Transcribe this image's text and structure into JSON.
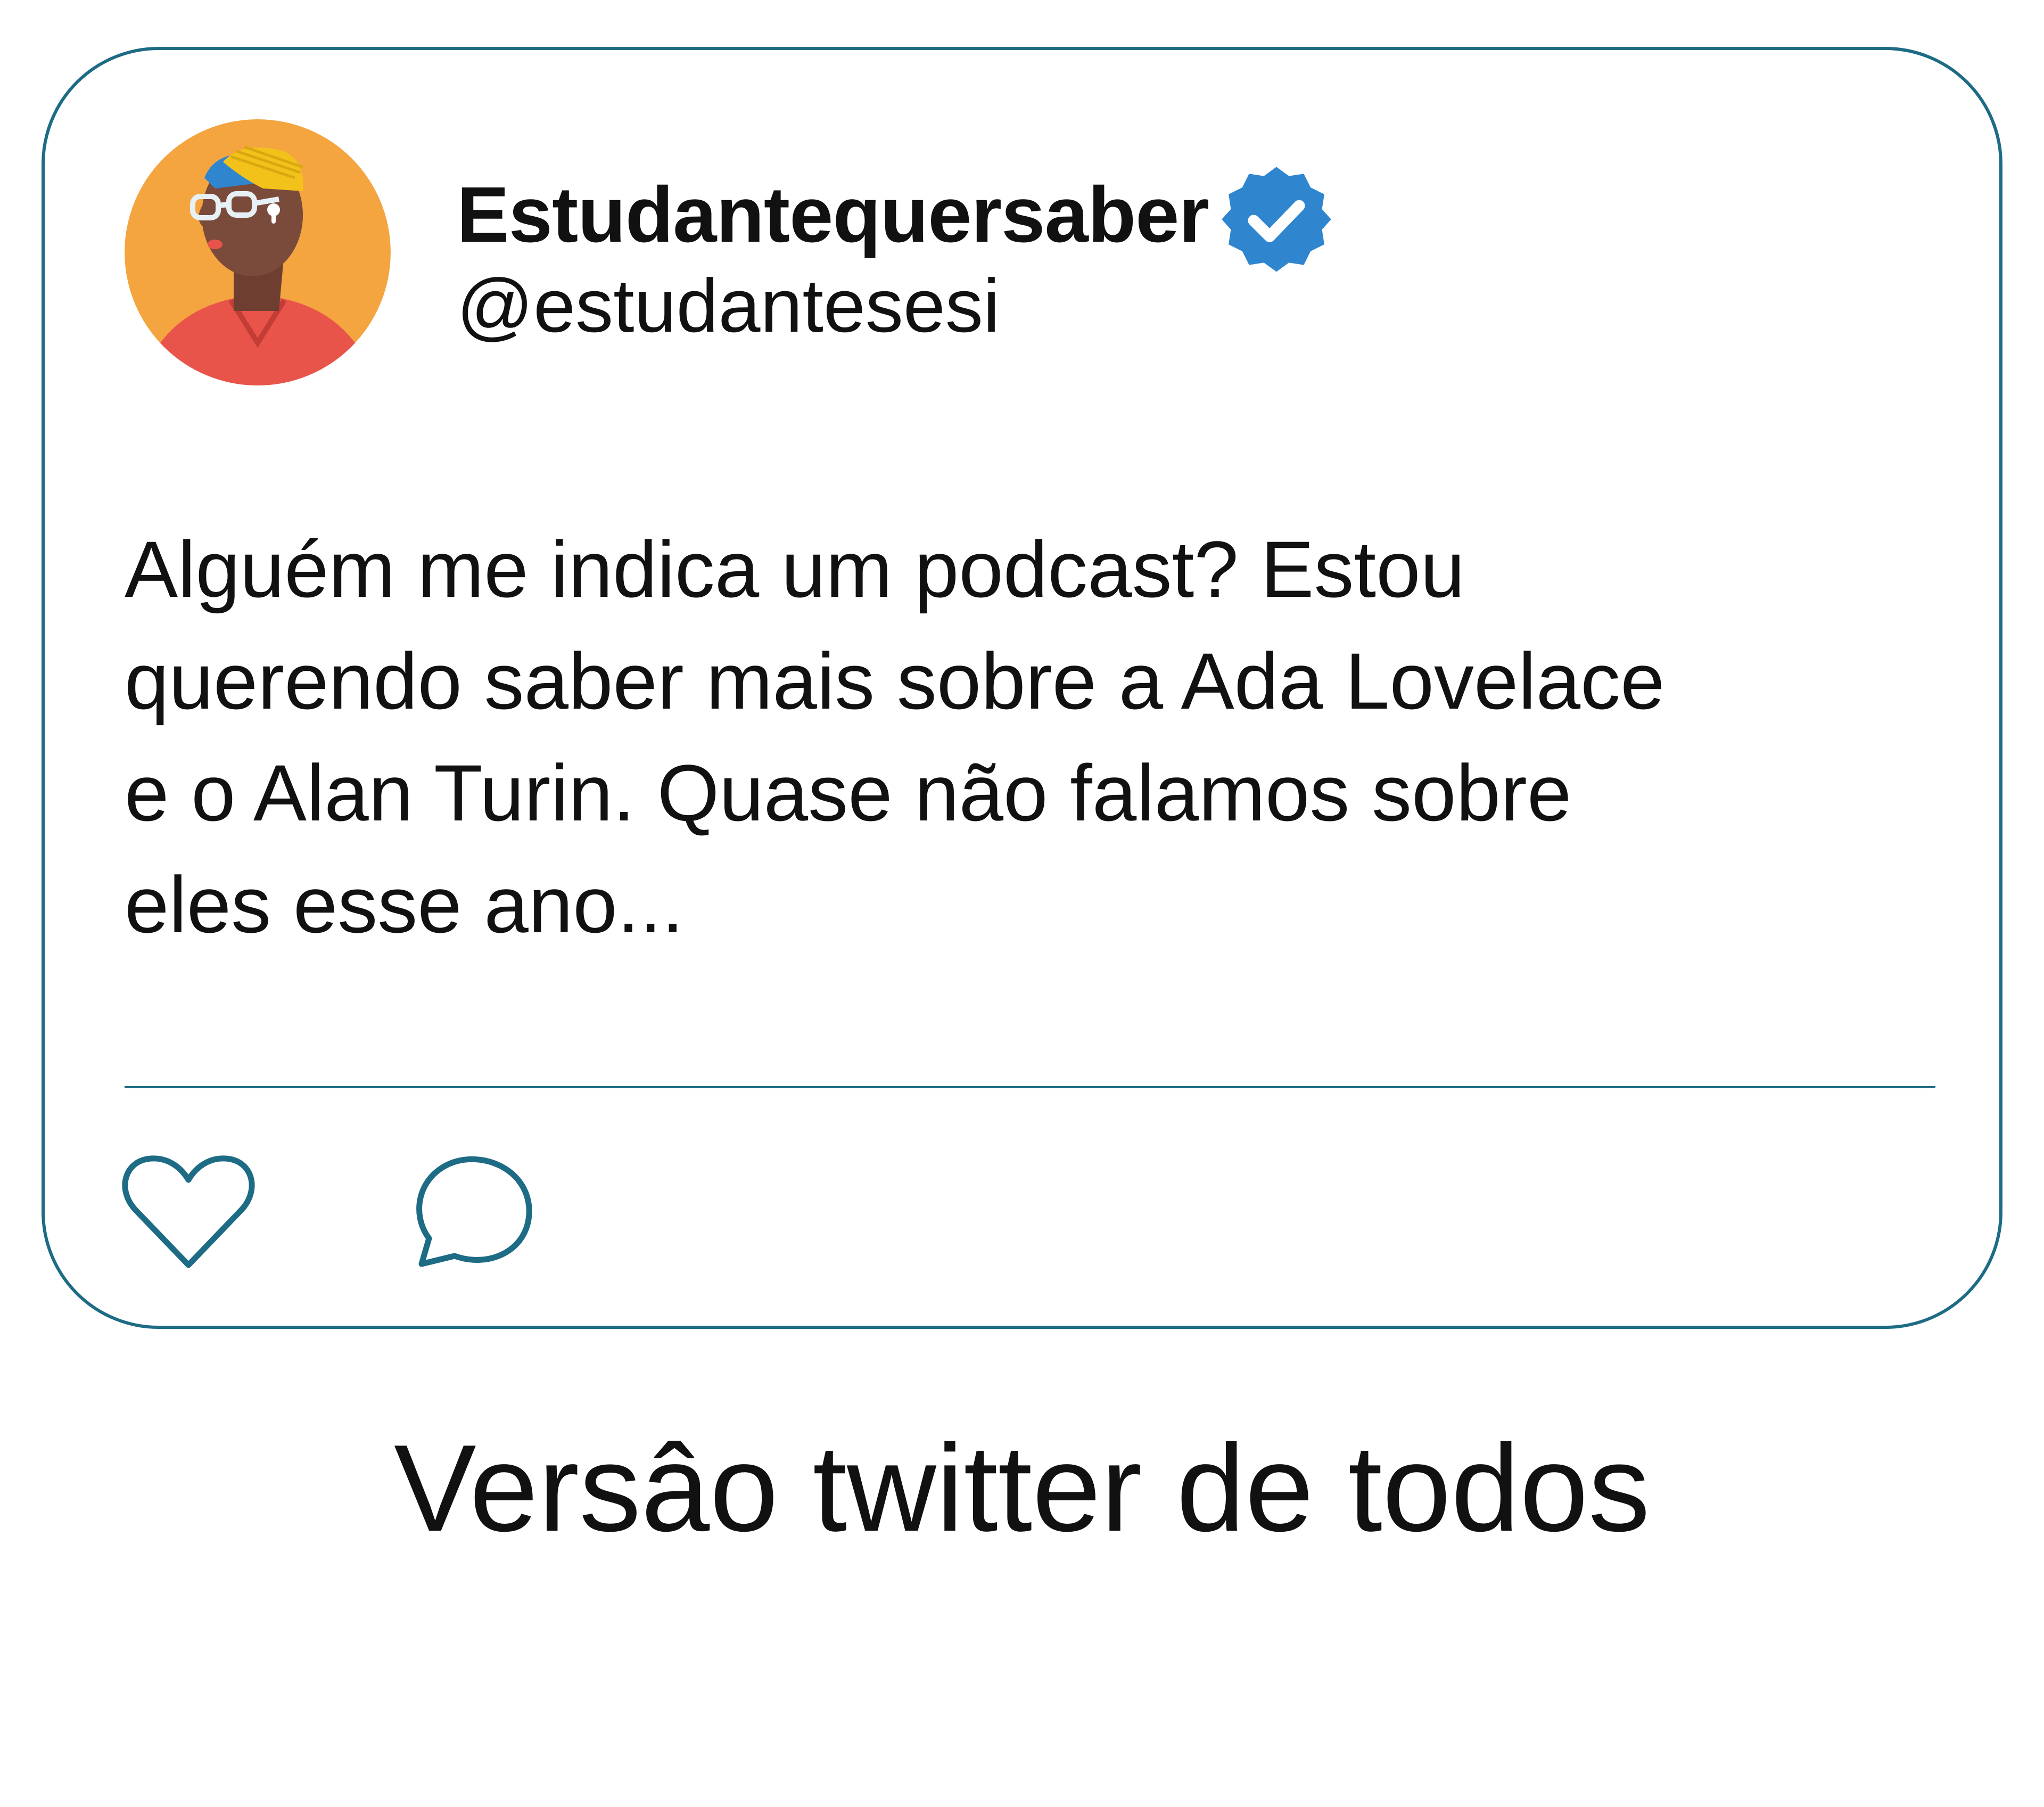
{
  "tweet": {
    "display_name": "Estudantequersaber",
    "handle": "@estudantesesi",
    "text_lines": [
      "Alguém me indica um podcast? Estou",
      "querendo saber mais sobre a Ada Lovelace",
      "e o Alan Turin. Quase não falamos sobre",
      "eles esse ano..."
    ],
    "verified": true,
    "avatar_icon": "avatar-person-with-beanie-glasses",
    "actions": [
      {
        "name": "like",
        "icon": "heart-icon"
      },
      {
        "name": "reply",
        "icon": "speech-bubble-icon"
      }
    ]
  },
  "caption": "Versâo twitter de todos",
  "colors": {
    "card_border": "#1d6b84",
    "divider": "#1d6b84",
    "icon_stroke": "#1d6b84",
    "verified_badge": "#2f86cf",
    "avatar_background": "#f4a540",
    "shirt": "#e9544a",
    "skin": "#7a4a3a",
    "beanie": "#f2c21b",
    "hair": "#2f86cf",
    "text": "#111111"
  }
}
